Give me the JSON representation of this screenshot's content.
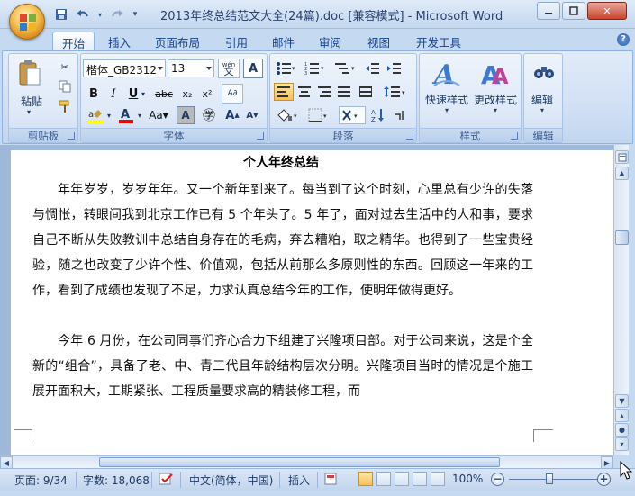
{
  "window": {
    "title": "2013年终总结范文大全(24篇).doc [兼容模式] - Microsoft Word",
    "min_icon": "minimize-icon",
    "max_icon": "maximize-icon",
    "close_icon": "close-icon"
  },
  "quick_access": {
    "save_icon": "save-icon",
    "undo_icon": "undo-icon",
    "redo_icon": "redo-icon",
    "customize_icon": "customize-dropdown-icon"
  },
  "tabs": [
    {
      "label": "开始",
      "active": true
    },
    {
      "label": "插入"
    },
    {
      "label": "页面布局"
    },
    {
      "label": "引用"
    },
    {
      "label": "邮件"
    },
    {
      "label": "审阅"
    },
    {
      "label": "视图"
    },
    {
      "label": "开发工具"
    }
  ],
  "ribbon": {
    "clipboard": {
      "label": "剪贴板",
      "paste_label": "粘贴"
    },
    "font": {
      "label": "字体",
      "font_name": "楷体_GB2312",
      "font_size": "13",
      "wen_label": "wén\n文"
    },
    "paragraph": {
      "label": "段落"
    },
    "styles": {
      "label": "样式",
      "quick_styles": "快速样式",
      "change_styles": "更改样式"
    },
    "editing": {
      "label": "编辑",
      "edit_label": "编辑"
    }
  },
  "document": {
    "title": "个人年终总结",
    "paragraphs": [
      "年年岁岁，岁岁年年。又一个新年到来了。每当到了这个时刻，心里总有少许的失落与惆怅，转眼间我到北京工作已有 5 个年头了。5 年了，面对过去生活中的人和事，要求自己不断从失败教训中总结自身存在的毛病，弃去糟粕，取之精华。也得到了一些宝贵经验，随之也改变了少许个性、价值观，包括从前那么多原则性的东西。回顾这一年来的工作，看到了成绩也发现了不足，力求认真总结今年的工作，使明年做得更好。",
      "今年 6 月份，在公司同事们齐心合力下组建了兴隆项目部。对于公司来说，这是个全新的“组合”，具备了老、中、青三代且年龄结构层次分明。兴隆项目当时的情况是个施工展开面积大，工期紧张、工程质量要求高的精装修工程，而"
    ]
  },
  "status": {
    "page": "页面: 9/34",
    "words": "字数: 18,068",
    "language": "中文(简体，中国)",
    "insert_mode": "插入",
    "zoom": "100%",
    "zoom_value": 100
  },
  "colors": {
    "accent": "#15428b",
    "ribbon_bg": "#d1e0f4",
    "highlight_yellow": "#ffff00",
    "font_color_red": "#ff0000"
  }
}
